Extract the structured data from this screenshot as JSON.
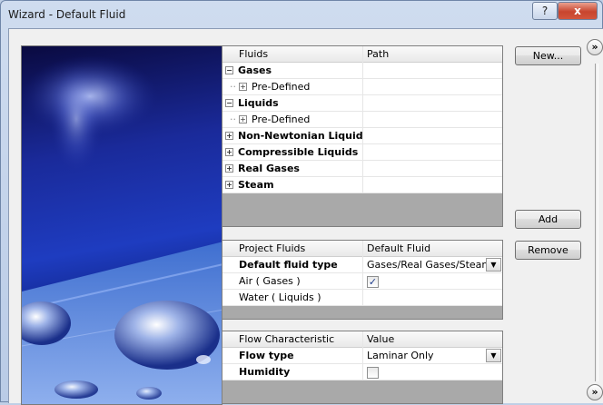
{
  "window": {
    "title": "Wizard - Default Fluid",
    "help_glyph": "?",
    "close_glyph": "x"
  },
  "fluids_panel": {
    "headers": [
      "Fluids",
      "Path"
    ],
    "rows": [
      {
        "label": "Gases",
        "expander": "−",
        "bold": true
      },
      {
        "label": "Pre-Defined",
        "expander": "+",
        "bold": false
      },
      {
        "label": "Liquids",
        "expander": "−",
        "bold": true
      },
      {
        "label": "Pre-Defined",
        "expander": "+",
        "bold": false
      },
      {
        "label": "Non-Newtonian Liquids",
        "expander": "+",
        "bold": true
      },
      {
        "label": "Compressible Liquids",
        "expander": "+",
        "bold": true
      },
      {
        "label": "Real Gases",
        "expander": "+",
        "bold": true
      },
      {
        "label": "Steam",
        "expander": "+",
        "bold": true
      }
    ]
  },
  "project_panel": {
    "headers": [
      "Project Fluids",
      "Default Fluid"
    ],
    "rows": [
      {
        "label": "Default fluid type",
        "value": "Gases/Real Gases/Steam",
        "bold": true
      },
      {
        "label": "Air ( Gases )",
        "checked": true
      },
      {
        "label": "Water ( Liquids )",
        "value": ""
      }
    ]
  },
  "flow_panel": {
    "headers": [
      "Flow Characteristic",
      "Value"
    ],
    "rows": [
      {
        "label": "Flow type",
        "value": "Laminar Only",
        "bold": true
      },
      {
        "label": "Humidity",
        "checked": false,
        "bold": true
      }
    ]
  },
  "buttons": {
    "new": "New...",
    "add": "Add",
    "remove": "Remove"
  },
  "glyphs": {
    "chevron": "»",
    "dropdown": "▼",
    "check": "✓"
  },
  "colors": {
    "title_bar": "#c4d4eb",
    "gray_area": "#a9a9a9",
    "close_red": "#c8452e"
  }
}
